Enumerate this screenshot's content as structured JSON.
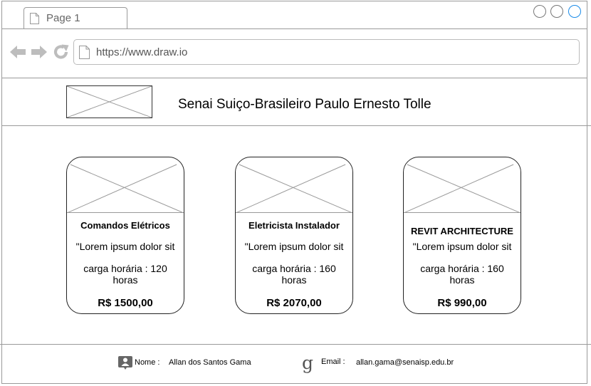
{
  "browser": {
    "tab_label": "Page 1",
    "url": "https://www.draw.io",
    "icons": {
      "back": "back-arrow-icon",
      "forward": "forward-arrow-icon",
      "reload": "reload-icon",
      "page": "page-icon"
    }
  },
  "header": {
    "title": "Senai Suiço-Brasileiro Paulo Ernesto Tolle"
  },
  "courses": [
    {
      "title": "Comandos Elétricos",
      "description": "\"Lorem ipsum dolor sit",
      "hours": "carga horária : 120 horas",
      "price": "R$ 1500,00"
    },
    {
      "title": "Eletricista Instalador",
      "description": "\"Lorem ipsum dolor sit",
      "hours": "carga horária : 160 horas",
      "price": "R$ 2070,00"
    },
    {
      "title": "REVIT ARCHITECTURE",
      "description": "\"Lorem ipsum dolor sit",
      "hours": "carga horária : 160 horas",
      "price": "R$ 990,00"
    }
  ],
  "footer": {
    "name_label": "Nome :",
    "name_value": "Allan dos Santos Gama",
    "email_label": "Email :",
    "email_value": "allan.gama@senaisp.edu.br"
  },
  "colors": {
    "frame_border": "#9a9a9a",
    "close_button": "#1a8be8",
    "nav_icon": "#bdbdbd"
  }
}
